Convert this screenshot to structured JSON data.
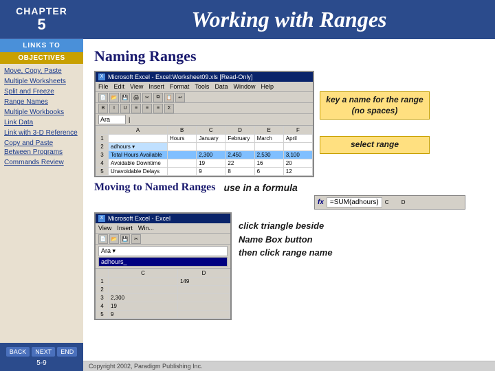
{
  "sidebar": {
    "chapter_label": "CHAPTER",
    "chapter_number": "5",
    "links_to": "LINKS TO",
    "objectives_label": "OBJECTIVES",
    "nav_items": [
      {
        "label": "Move, Copy, Paste",
        "id": "move-copy-paste"
      },
      {
        "label": "Multiple Worksheets",
        "id": "multiple-worksheets"
      },
      {
        "label": "Split and Freeze",
        "id": "split-and-freeze"
      },
      {
        "label": "Range Names",
        "id": "range-names"
      },
      {
        "label": "Multiple Workbooks",
        "id": "multiple-workbooks"
      },
      {
        "label": "Link Data",
        "id": "link-data"
      },
      {
        "label": "Link with 3-D Reference",
        "id": "link-3d-reference"
      },
      {
        "label": "Copy and Paste Between Programs",
        "id": "copy-paste-programs"
      },
      {
        "label": "Commands Review",
        "id": "commands-review"
      }
    ],
    "back_label": "BACK",
    "next_label": "NEXT",
    "end_label": "END",
    "slide_number": "5-9"
  },
  "header": {
    "title": "Working with Ranges"
  },
  "content": {
    "naming_ranges_title": "Naming Ranges",
    "excel_title": "Microsoft Excel - Excel:Worksheet09.xls [Read-Only]",
    "menu_items": [
      "File",
      "Edit",
      "View",
      "Insert",
      "Format",
      "Tools",
      "Data",
      "Window",
      "Help"
    ],
    "name_box_value": "Ara",
    "grid": {
      "col_headers": [
        "",
        "A",
        "B",
        "C",
        "D",
        "E",
        "F"
      ],
      "rows": [
        {
          "row": "1",
          "cells": [
            "",
            "Hours",
            "January",
            "February",
            "March",
            "April",
            ""
          ]
        },
        {
          "row": "2",
          "cells": [
            "adhours_",
            "",
            "",
            "",
            "",
            "",
            ""
          ]
        },
        {
          "row": "3",
          "cells": [
            "3",
            "Total Hours Available",
            "",
            "2,300",
            "2,450",
            "2,530",
            "3,100"
          ]
        },
        {
          "row": "4",
          "cells": [
            "4",
            "Avoidable Downtime",
            "",
            "19",
            "22",
            "16",
            "20"
          ]
        },
        {
          "row": "5",
          "cells": [
            "5",
            "Unavoidable Delays",
            "",
            "9",
            "8",
            "6",
            "12"
          ]
        }
      ]
    },
    "annotation_key_name": "key a name for the range (no spaces)",
    "annotation_select": "select range",
    "moving_title": "Moving to Named Ranges",
    "formula_annotation": "use in a formula",
    "formula_value": "=SUM(adhours)",
    "excel2_title": "Microsoft Excel - Excel",
    "bottom_name_items": [
      "Ara",
      "adhours_"
    ],
    "click_annotation": "click triangle beside\nName Box button\nthen click range name",
    "grid2": {
      "col_headers": [
        "",
        "C",
        "D"
      ],
      "selected_value": "149",
      "rows": [
        {
          "row": "1",
          "cells": [
            "",
            "",
            ""
          ]
        },
        {
          "row": "2",
          "cells": [
            "",
            "",
            ""
          ]
        },
        {
          "row": "3",
          "cells": [
            "",
            "2,300",
            ""
          ]
        },
        {
          "row": "4",
          "cells": [
            "",
            "19",
            ""
          ]
        },
        {
          "row": "5",
          "cells": [
            "",
            "9",
            ""
          ]
        }
      ]
    },
    "copyright": "Copyright 2002, Paradigm Publishing Inc."
  }
}
